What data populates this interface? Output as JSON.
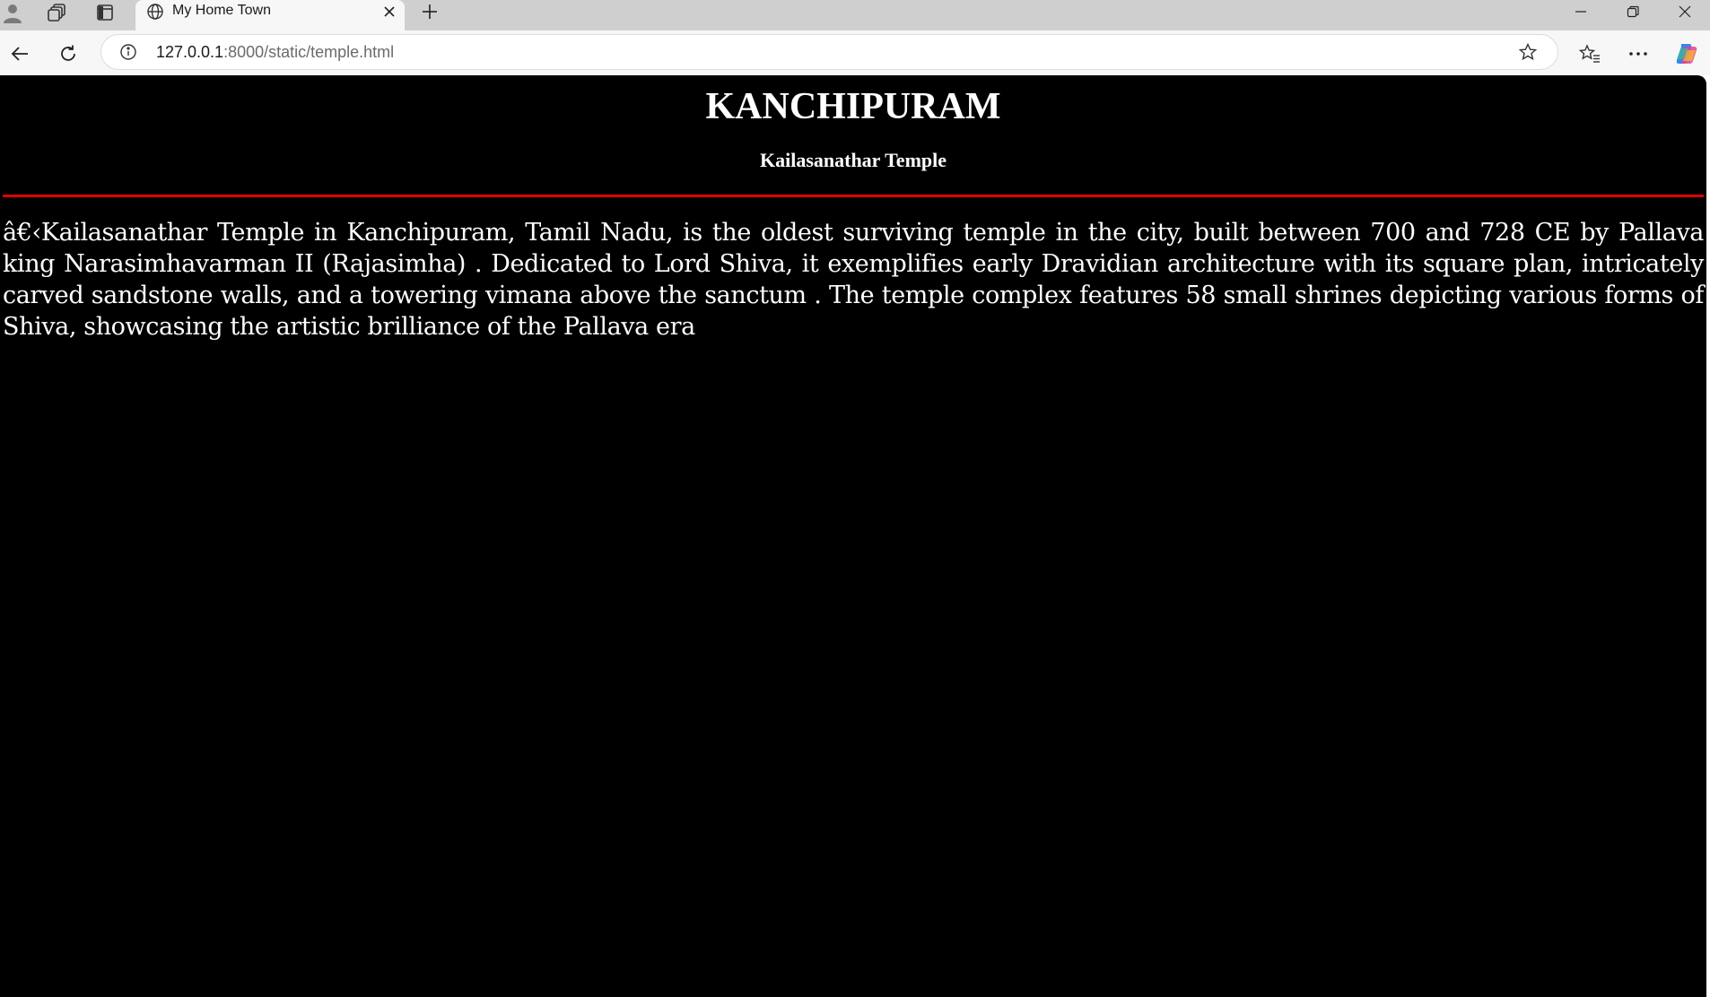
{
  "browser": {
    "tab": {
      "title": "My Home Town"
    },
    "address": {
      "url_host": "127.0.0.1",
      "url_rest": ":8000/static/temple.html"
    }
  },
  "page": {
    "heading": "KANCHIPURAM",
    "subheading": "Kailasanathar Temple",
    "paragraph": "â€‹Kailasanathar Temple in Kanchipuram, Tamil Nadu, is the oldest surviving temple in the city, built between 700 and 728 CE by Pallava king Narasimhavarman II (Rajasimha) . Dedicated to Lord Shiva, it exemplifies early Dravidian architecture with its square plan, intricately carved sandstone walls, and a towering vimana above the sanctum . The temple complex features 58 small shrines depicting various forms of Shiva, showcasing the artistic brilliance of the Pallava era",
    "background_color": "#000000",
    "text_color": "#ffffff",
    "rule_color": "#e00000"
  }
}
